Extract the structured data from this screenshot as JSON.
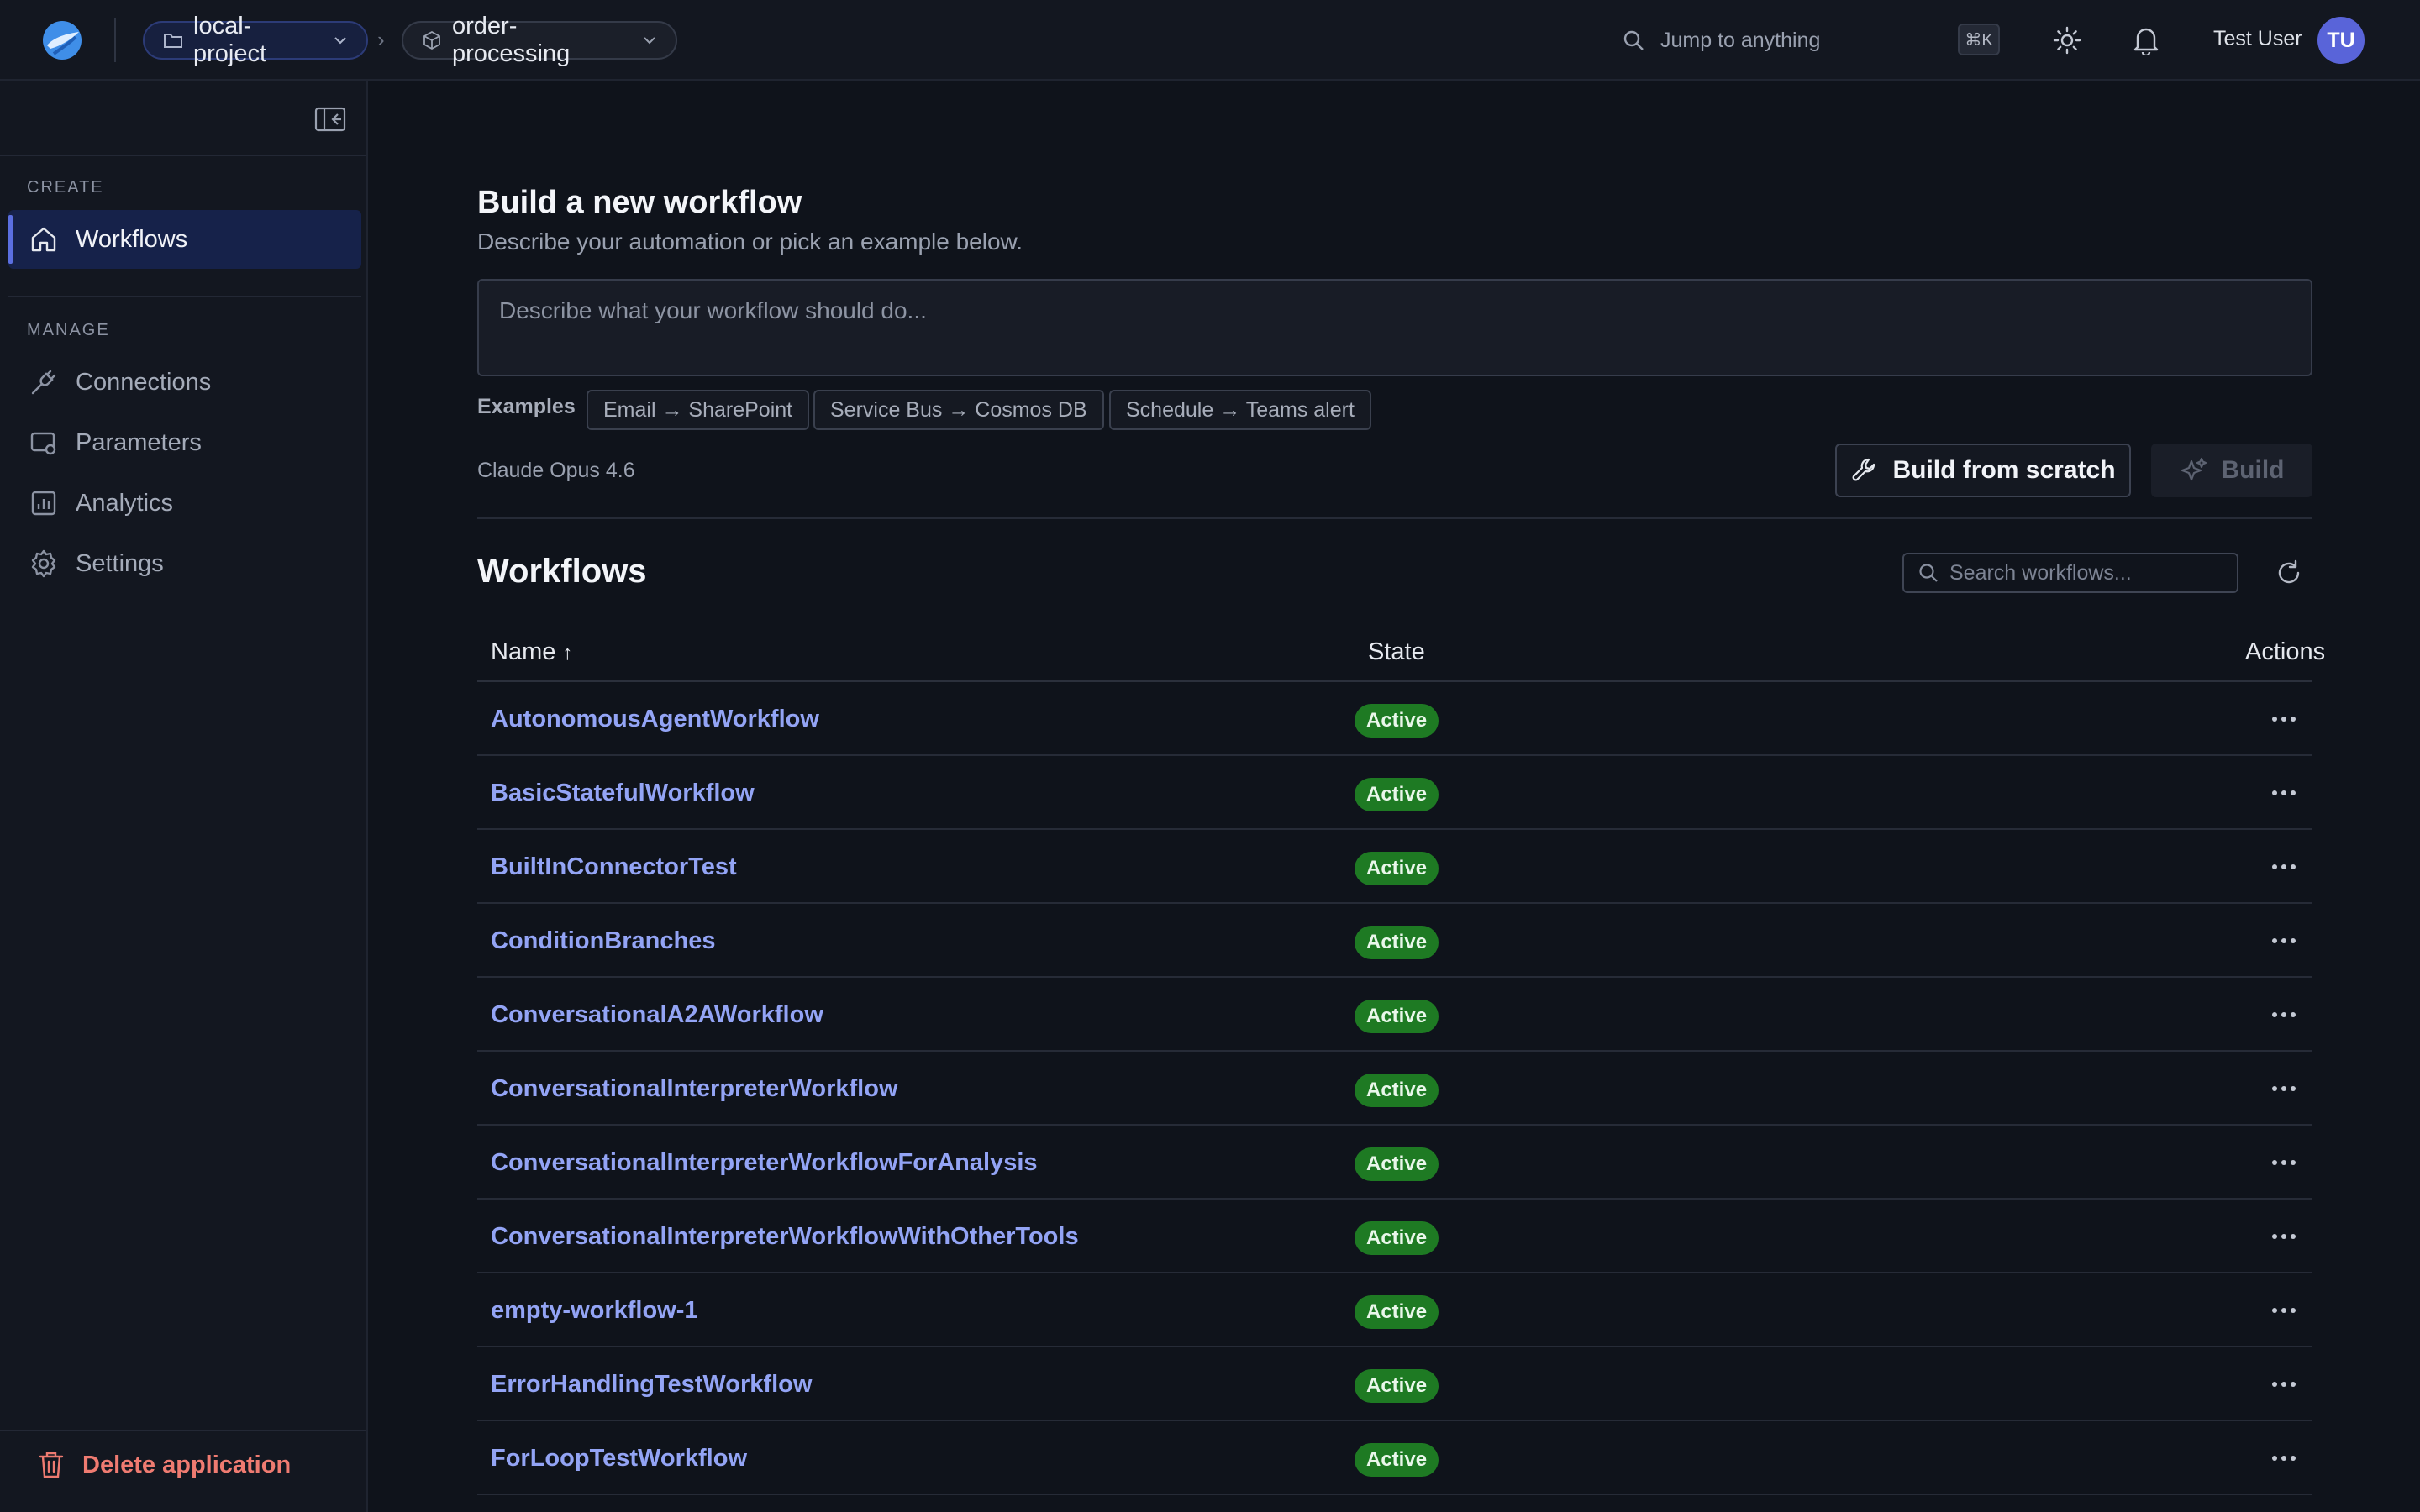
{
  "topbar": {
    "project": "local-project",
    "workflow": "order-processing",
    "jump_placeholder": "Jump to anything",
    "shortcut": "⌘K",
    "user_name": "Test User",
    "user_initials": "TU"
  },
  "sidebar": {
    "create_label": "CREATE",
    "manage_label": "MANAGE",
    "create_items": [
      {
        "label": "Workflows",
        "icon": "home-icon",
        "active": true
      }
    ],
    "manage_items": [
      {
        "label": "Connections",
        "icon": "plug-icon"
      },
      {
        "label": "Parameters",
        "icon": "parameters-icon"
      },
      {
        "label": "Analytics",
        "icon": "analytics-icon"
      },
      {
        "label": "Settings",
        "icon": "gear-icon"
      }
    ],
    "delete_label": "Delete application"
  },
  "builder": {
    "title": "Build a new workflow",
    "subtitle": "Describe your automation or pick an example below.",
    "prompt_placeholder": "Describe what your workflow should do...",
    "examples_label": "Examples",
    "examples": [
      "Email → SharePoint",
      "Service Bus → Cosmos DB",
      "Schedule → Teams alert"
    ],
    "model": "Claude Opus 4.6",
    "scratch_label": "Build from scratch",
    "build_label": "Build"
  },
  "workflows": {
    "title": "Workflows",
    "search_placeholder": "Search workflows...",
    "columns": {
      "name": "Name",
      "sort_indicator": "↑",
      "state": "State",
      "actions": "Actions"
    },
    "rows": [
      {
        "name": "AutonomousAgentWorkflow",
        "state": "Active"
      },
      {
        "name": "BasicStatefulWorkflow",
        "state": "Active"
      },
      {
        "name": "BuiltInConnectorTest",
        "state": "Active"
      },
      {
        "name": "ConditionBranches",
        "state": "Active"
      },
      {
        "name": "ConversationalA2AWorkflow",
        "state": "Active"
      },
      {
        "name": "ConversationalInterpreterWorkflow",
        "state": "Active"
      },
      {
        "name": "ConversationalInterpreterWorkflowForAnalysis",
        "state": "Active"
      },
      {
        "name": "ConversationalInterpreterWorkflowWithOtherTools",
        "state": "Active"
      },
      {
        "name": "empty-workflow-1",
        "state": "Active"
      },
      {
        "name": "ErrorHandlingTestWorkflow",
        "state": "Active"
      },
      {
        "name": "ForLoopTestWorkflow",
        "state": "Active"
      }
    ]
  },
  "colors": {
    "accent": "#5b6fe0",
    "link": "#93a4f5",
    "active_badge": "#1e7a23",
    "danger": "#ef7b71"
  }
}
